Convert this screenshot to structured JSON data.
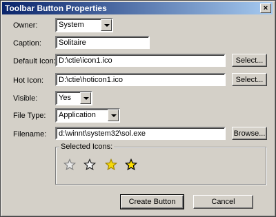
{
  "window": {
    "title": "Toolbar Button Properties"
  },
  "fields": {
    "owner": {
      "label": "Owner:",
      "value": "System"
    },
    "caption": {
      "label": "Caption:",
      "value": "Solitaire"
    },
    "default_icon": {
      "label": "Default Icon:",
      "value": "D:\\ctie\\icon1.ico",
      "button": "Select..."
    },
    "hot_icon": {
      "label": "Hot Icon:",
      "value": "D:\\ctie\\hoticon1.ico",
      "button": "Select..."
    },
    "visible": {
      "label": "Visible:",
      "value": "Yes"
    },
    "file_type": {
      "label": "File Type:",
      "value": "Application"
    },
    "filename": {
      "label": "Filename:",
      "value": "d:\\winnt\\system32\\sol.exe",
      "button": "Browse..."
    }
  },
  "selected_icons": {
    "label": "Selected Icons:",
    "icons": [
      "star-outline-grey-icon",
      "star-outline-dark-icon",
      "star-filled-yellow-icon",
      "star-filled-yellow-hot-icon"
    ]
  },
  "buttons": {
    "create": "Create Button",
    "cancel": "Cancel"
  },
  "colors": {
    "titlebar_start": "#0a246a",
    "titlebar_end": "#a6caf0",
    "face": "#d4d0c8",
    "star_yellow": "#f5d90a"
  }
}
